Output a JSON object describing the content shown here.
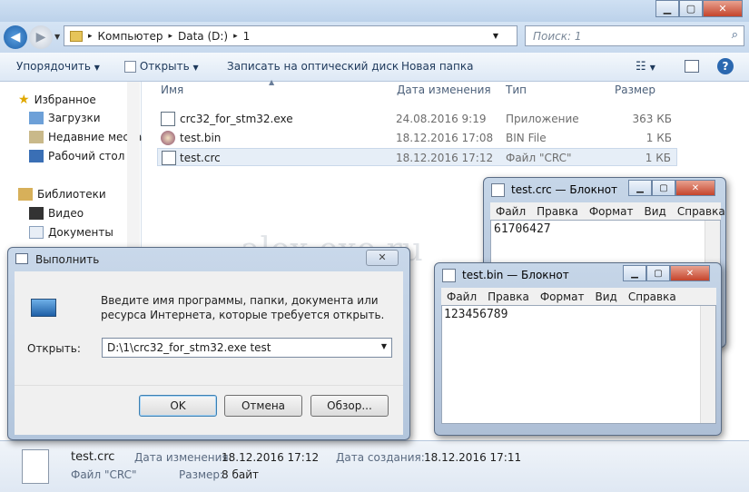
{
  "explorer": {
    "breadcrumb": [
      "Компьютер",
      "Data (D:)",
      "1"
    ],
    "search_placeholder": "Поиск: 1",
    "toolbar": {
      "organize": "Упорядочить",
      "open": "Открыть",
      "burn": "Записать на оптический диск",
      "new_folder": "Новая папка"
    },
    "nav": {
      "favorites": "Избранное",
      "downloads": "Загрузки",
      "recent": "Недавние места",
      "desktop": "Рабочий стол",
      "libraries": "Библиотеки",
      "video": "Видео",
      "documents": "Документы"
    },
    "columns": {
      "name": "Имя",
      "date": "Дата изменения",
      "type": "Тип",
      "size": "Размер"
    },
    "files": [
      {
        "name": "crc32_for_stm32.exe",
        "date": "24.08.2016 9:19",
        "type": "Приложение",
        "size": "363 КБ"
      },
      {
        "name": "test.bin",
        "date": "18.12.2016 17:08",
        "type": "BIN File",
        "size": "1 КБ"
      },
      {
        "name": "test.crc",
        "date": "18.12.2016 17:12",
        "type": "Файл \"CRC\"",
        "size": "1 КБ"
      }
    ],
    "status": {
      "filename": "test.crc",
      "filetype": "Файл \"CRC\"",
      "modified_label": "Дата изменения:",
      "modified_value": "18.12.2016 17:12",
      "size_label": "Размер:",
      "size_value": "8 байт",
      "created_label": "Дата создания:",
      "created_value": "18.12.2016 17:11"
    }
  },
  "notepad_crc": {
    "title": "test.crc — Блокнот",
    "menu": [
      "Файл",
      "Правка",
      "Формат",
      "Вид",
      "Справка"
    ],
    "content": "61706427"
  },
  "notepad_bin": {
    "title": "test.bin — Блокнот",
    "menu": [
      "Файл",
      "Правка",
      "Формат",
      "Вид",
      "Справка"
    ],
    "content": "123456789"
  },
  "run": {
    "title": "Выполнить",
    "description": "Введите имя программы, папки, документа или ресурса Интернета, которые требуется открыть.",
    "open_label": "Открыть:",
    "command": "D:\\1\\crc32_for_stm32.exe test",
    "ok": "OK",
    "cancel": "Отмена",
    "browse": "Обзор..."
  },
  "watermark": "alex-exe.ru"
}
